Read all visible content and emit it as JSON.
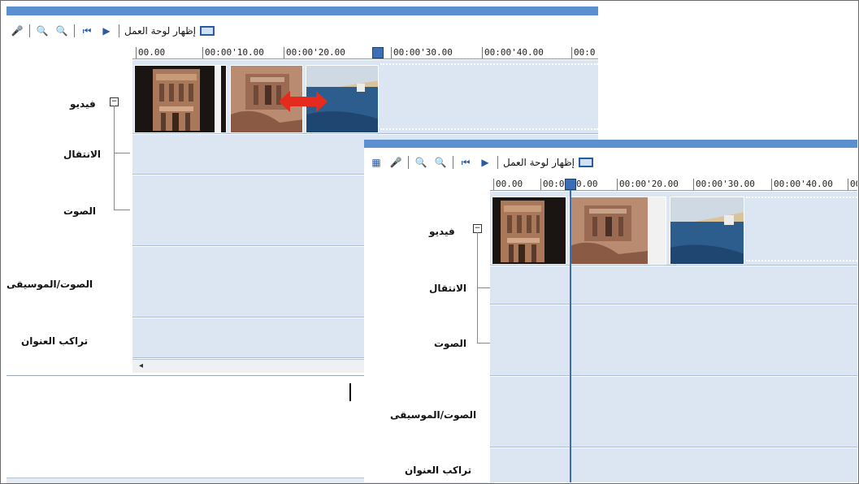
{
  "toolbar": {
    "show_storyboard_label": "إظهار لوحة العمل"
  },
  "front": {
    "toolbar": {
      "show_storyboard_label": "إظهار لوحة العمل"
    }
  },
  "timeline_back": {
    "ruler_ticks": [
      "00.00",
      "00:00'10.00",
      "00:00'20.00",
      "00:00'30.00",
      "00:00'40.00",
      "00:0"
    ],
    "tracks": [
      "فيديو",
      "الانتقال",
      "الصوت",
      "الصوت/الموسيقى",
      "تراكب العنوان"
    ],
    "transition_arrow": "double-arrow-icon"
  },
  "timeline_front": {
    "ruler_ticks": [
      "00.00",
      "00:0",
      "0.00",
      "00:00'20.00",
      "00:00'30.00",
      "00:00'40.00",
      "00"
    ],
    "tracks": [
      "فيديو",
      "الانتقال",
      "الصوت",
      "الصوت/الموسيقى",
      "تراكب العنوان"
    ]
  },
  "colors": {
    "accent": "#5b8fd0",
    "track_bg": "#dce6f2",
    "playhead": "#3a6fb5"
  }
}
